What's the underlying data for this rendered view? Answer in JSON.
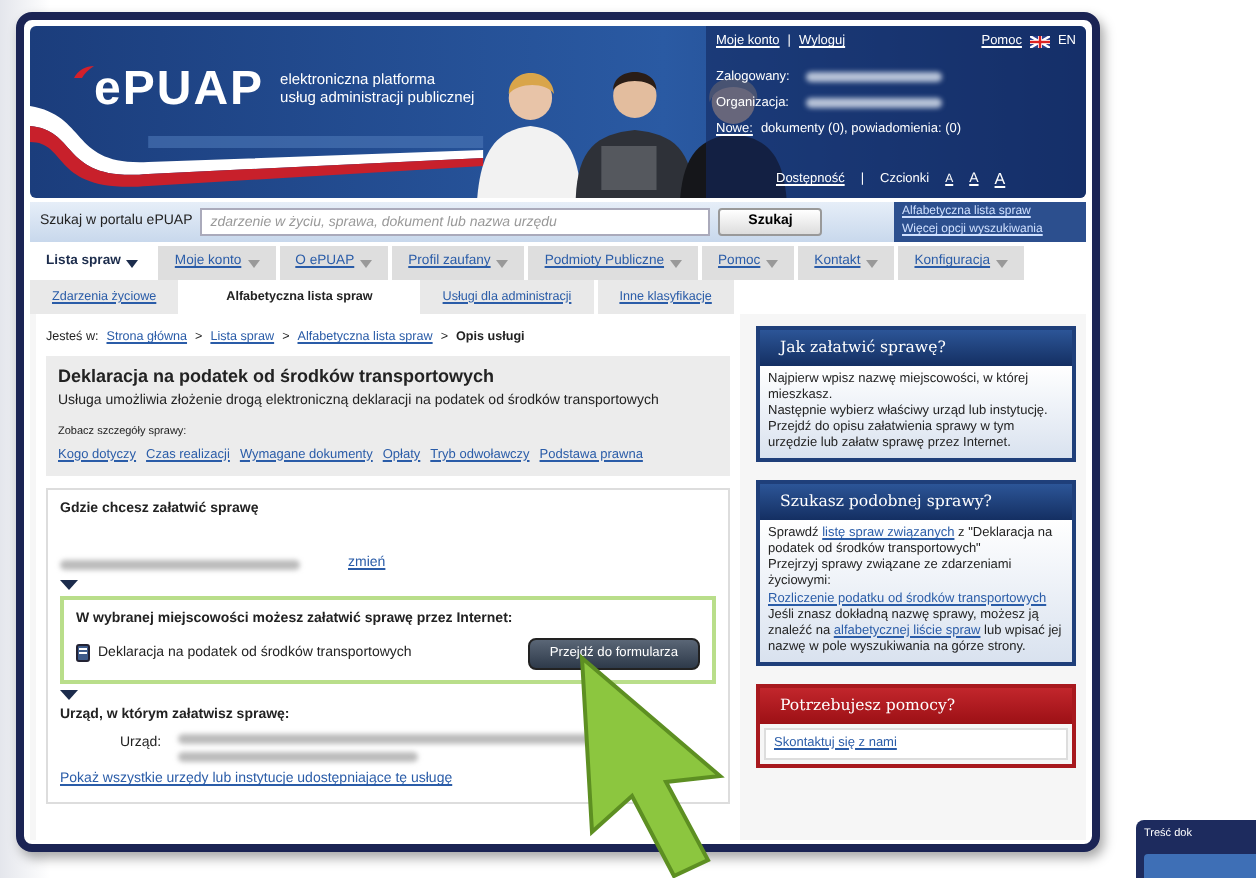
{
  "banner": {
    "logo": "ePUAP",
    "tagline": [
      "elektroniczna platforma",
      "usług administracji publicznej"
    ]
  },
  "user_panel": {
    "links": [
      "Moje konto",
      "Wyloguj"
    ],
    "separator": "|",
    "help": "Pomoc",
    "language": "EN",
    "fields": [
      "Zalogowany:",
      "Organizacja:"
    ],
    "new_link": "Nowe:",
    "new_text": "dokumenty (0), powiadomienia: (0)",
    "accessibility": "Dostępność",
    "fonts_label": "Czcionki",
    "font_sizes": [
      "A",
      "A",
      "A"
    ]
  },
  "search": {
    "label": "Szukaj w portalu ePUAP",
    "placeholder": "zdarzenie w życiu, sprawa, dokument lub nazwa urzędu",
    "button": "Szukaj",
    "links": [
      "Alfabetyczna lista spraw",
      "Więcej opcji wyszukiwania"
    ]
  },
  "menu": [
    {
      "label": "Lista spraw",
      "selected": true
    },
    {
      "label": "Moje konto",
      "selected": false
    },
    {
      "label": "O ePUAP",
      "selected": false
    },
    {
      "label": "Profil zaufany",
      "selected": false
    },
    {
      "label": "Podmioty Publiczne",
      "selected": false
    },
    {
      "label": "Pomoc",
      "selected": false
    },
    {
      "label": "Kontakt",
      "selected": false
    },
    {
      "label": "Konfiguracja",
      "selected": false
    }
  ],
  "submenu": [
    {
      "label": "Zdarzenia życiowe",
      "selected": false
    },
    {
      "label": "Alfabetyczna lista spraw",
      "selected": true
    },
    {
      "label": "Usługi dla administracji",
      "selected": false
    },
    {
      "label": "Inne klasyfikacje",
      "selected": false
    }
  ],
  "breadcrumb": {
    "prefix": "Jesteś w:",
    "separator": ">",
    "items": [
      {
        "label": "Strona główna",
        "current": false
      },
      {
        "label": "Lista spraw",
        "current": false
      },
      {
        "label": "Alfabetyczna lista spraw",
        "current": false
      },
      {
        "label": "Opis usługi",
        "current": true
      }
    ]
  },
  "service": {
    "title": "Deklaracja na podatek od środków transportowych",
    "description": "Usługa umożliwia złożenie drogą elektroniczną deklaracji na podatek od środków transportowych",
    "details_label": "Zobacz szczegóły sprawy:",
    "detail_links": [
      "Kogo dotyczy",
      "Czas realizacji",
      "Wymagane dokumenty",
      "Opłaty",
      "Tryb odwoławczy",
      "Podstawa prawna"
    ]
  },
  "location": {
    "heading": "Gdzie chcesz załatwić sprawę",
    "change_link": "zmień",
    "online": {
      "heading": "W wybranej miejscowości możesz załatwić sprawę przez Internet:",
      "form_name": "Deklaracja na podatek od środków transportowych",
      "button": "Przejdź do formularza"
    },
    "office_heading": "Urząd, w którym załatwisz sprawę:",
    "office_label": "Urząd:",
    "all_offices_link": "Pokaż wszystkie urzędy lub instytucje udostępniające tę usługę"
  },
  "sidebar": [
    {
      "kind": "info",
      "title": "Jak załatwić sprawę?",
      "paragraphs": [
        [
          {
            "text": "Najpierw wpisz nazwę miejscowości, w której mieszkasz."
          }
        ],
        [
          {
            "text": "Następnie wybierz właściwy urząd lub instytucję."
          }
        ],
        [
          {
            "text": "Przejdź do opisu załatwienia sprawy w tym urzędzie lub załatw sprawę przez Internet."
          }
        ]
      ]
    },
    {
      "kind": "info",
      "title": "Szukasz podobnej sprawy?",
      "paragraphs": [
        [
          {
            "text": "Sprawdź "
          },
          {
            "text": "listę spraw związanych",
            "link": true
          },
          {
            "text": " z \"Deklaracja na podatek od środków transportowych\""
          }
        ],
        [
          {
            "text": "Przejrzyj sprawy związane ze zdarzeniami życiowymi:"
          }
        ],
        [
          {
            "text": "Rozliczenie podatku od środków transportowych",
            "link": true
          }
        ],
        [
          {
            "text": "Jeśli znasz dokładną nazwę sprawy, możesz ją znaleźć na "
          },
          {
            "text": "alfabetycznej liście spraw",
            "link": true
          },
          {
            "text": " lub wpisać jej nazwę w pole wyszukiwania na górze strony."
          }
        ]
      ]
    },
    {
      "kind": "help",
      "title": "Potrzebujesz pomocy?",
      "paragraphs": [
        [
          {
            "text": "Skontaktuj się z nami",
            "link": true
          }
        ]
      ]
    }
  ],
  "background_window": {
    "title": "Treść dok"
  }
}
